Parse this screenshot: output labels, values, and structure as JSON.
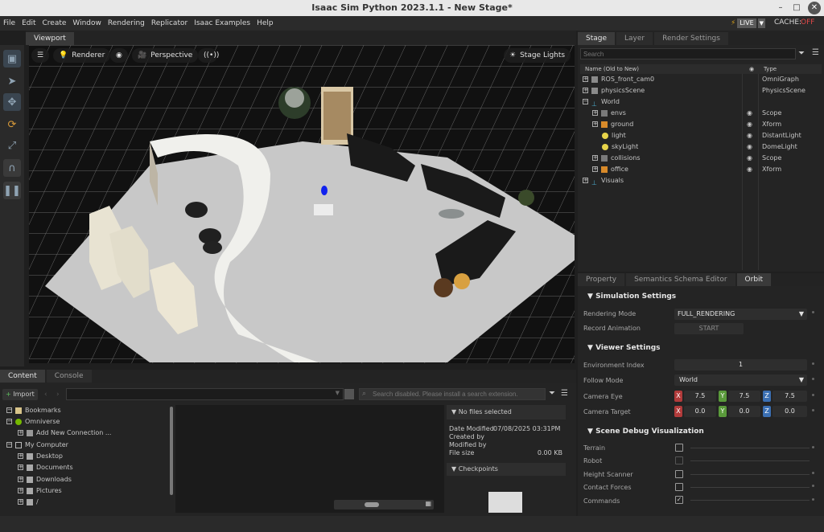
{
  "window": {
    "title": "Isaac Sim Python 2023.1.1 - New Stage*",
    "min": "–",
    "max": "□",
    "close": "✕"
  },
  "menu": [
    "File",
    "Edit",
    "Create",
    "Window",
    "Rendering",
    "Replicator",
    "Isaac Examples",
    "Help"
  ],
  "status": {
    "live": "LIVE",
    "cache_label": "CACHE:",
    "cache_value": "OFF"
  },
  "viewport": {
    "tab": "Viewport",
    "renderer": "Renderer",
    "perspective": "Perspective",
    "stage_lights": "Stage Lights"
  },
  "stage": {
    "tabs": [
      "Stage",
      "Layer",
      "Render Settings"
    ],
    "search_placeholder": "Search",
    "col_name": "Name (Old to New)",
    "col_type": "Type",
    "rows": [
      {
        "name": "ROS_front_cam0",
        "type": "OmniGraph"
      },
      {
        "name": "physicsScene",
        "type": "PhysicsScene"
      },
      {
        "name": "World",
        "type": ""
      },
      {
        "name": "envs",
        "type": "Scope"
      },
      {
        "name": "ground",
        "type": "Xform"
      },
      {
        "name": "light",
        "type": "DistantLight"
      },
      {
        "name": "skyLight",
        "type": "DomeLight"
      },
      {
        "name": "collisions",
        "type": "Scope"
      },
      {
        "name": "office",
        "type": "Xform"
      },
      {
        "name": "Visuals",
        "type": ""
      }
    ]
  },
  "orbit": {
    "tabs": [
      "Property",
      "Semantics Schema Editor",
      "Orbit"
    ],
    "sim_title": "Simulation Settings",
    "rendering_mode_label": "Rendering Mode",
    "rendering_mode_value": "FULL_RENDERING",
    "record_label": "Record Animation",
    "record_button": "START",
    "viewer_title": "Viewer Settings",
    "env_index_label": "Environment Index",
    "env_index_value": "1",
    "follow_label": "Follow Mode",
    "follow_value": "World",
    "eye_label": "Camera Eye",
    "eye": {
      "x": "7.5",
      "y": "7.5",
      "z": "7.5"
    },
    "target_label": "Camera Target",
    "target": {
      "x": "0.0",
      "y": "0.0",
      "z": "0.0"
    },
    "axis": {
      "x": "X",
      "y": "Y",
      "z": "Z"
    },
    "debug_title": "Scene Debug Visualization",
    "debug": [
      "Terrain",
      "Robot",
      "Height Scanner",
      "Contact Forces",
      "Commands"
    ]
  },
  "content": {
    "tabs": [
      "Content",
      "Console"
    ],
    "import": "Import",
    "search_placeholder": "Search disabled. Please install a search extension.",
    "tree": [
      "Bookmarks",
      "Omniverse",
      "Add New Connection ...",
      "My Computer",
      "Desktop",
      "Documents",
      "Downloads",
      "Pictures",
      "/"
    ],
    "info_title": "No files selected",
    "date_label": "Date Modified",
    "date_value": "07/08/2025 03:31PM",
    "created_label": "Created by",
    "modified_label": "Modified by",
    "size_label": "File size",
    "size_value": "0.00 KB",
    "checkpoints": "Checkpoints"
  },
  "colors": {
    "accent": "#e08a1e",
    "x": "#b23b3b",
    "y": "#5a9a3b",
    "z": "#3b6fb2",
    "live": "#d8a01a",
    "cache_off": "#e04848"
  }
}
